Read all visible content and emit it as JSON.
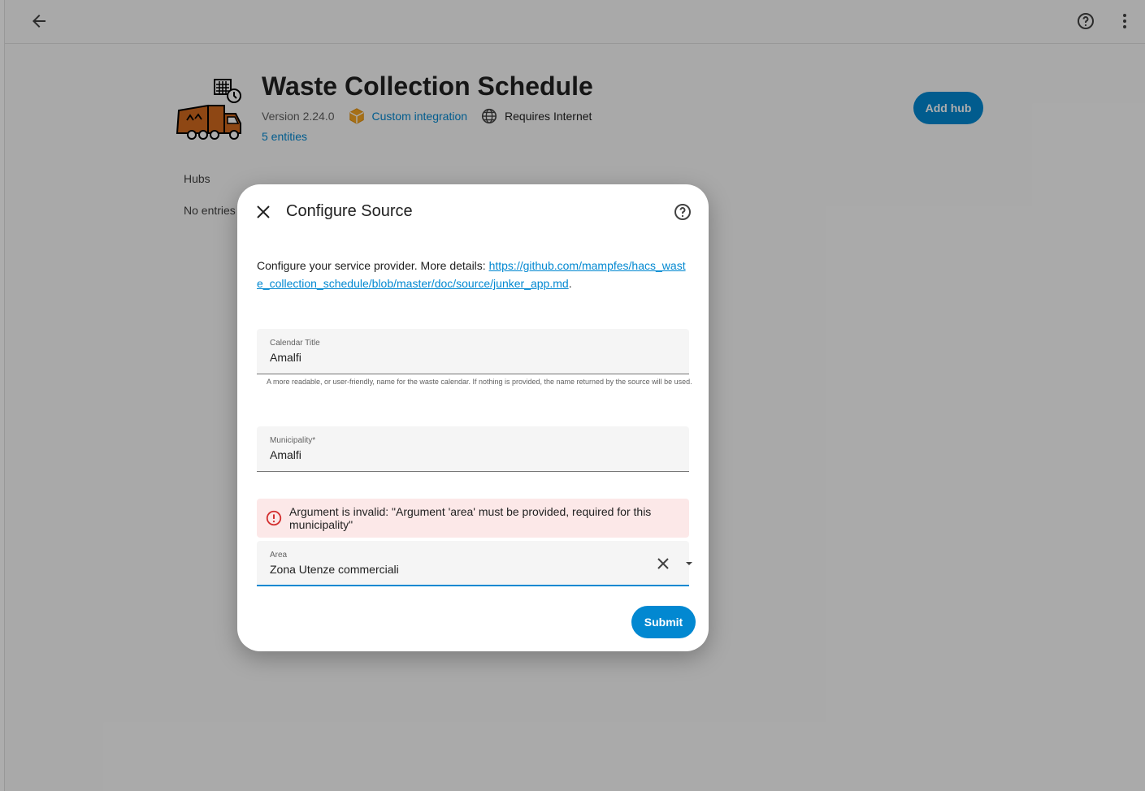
{
  "header": {
    "back_icon": "arrow-left-icon",
    "help_icon": "help-circle-icon",
    "more_icon": "dots-vertical-icon"
  },
  "integration": {
    "title": "Waste Collection Schedule",
    "version": "Version 2.24.0",
    "custom_label": "Custom integration",
    "requires_label": "Requires Internet",
    "entities_label": "5 entities",
    "add_hub_label": "Add hub",
    "hubs_label": "Hubs",
    "no_entries_label": "No entries"
  },
  "dialog": {
    "title": "Configure Source",
    "description": "Configure your service provider. More details: ",
    "link": "https://github.com/mampfes/hacs_waste_collection_schedule/blob/master/doc/source/junker_app.md",
    "period": ".",
    "calendar": {
      "label": "Calendar Title",
      "value": "Amalfi",
      "helper": "A more readable, or user-friendly, name for the waste calendar. If nothing is provided, the name returned by the source will be used."
    },
    "municipality": {
      "label": "Municipality*",
      "value": "Amalfi"
    },
    "error": {
      "message": "Argument is invalid: \"Argument 'area' must be provided, required for this municipality\""
    },
    "area": {
      "label": "Area",
      "value": "Zona Utenze commerciali"
    },
    "submit_label": "Submit"
  },
  "colors": {
    "accent": "#0288d1",
    "error": "#d32f2f",
    "error_bg": "#fce8e8",
    "logo_orange": "#d2691e"
  }
}
